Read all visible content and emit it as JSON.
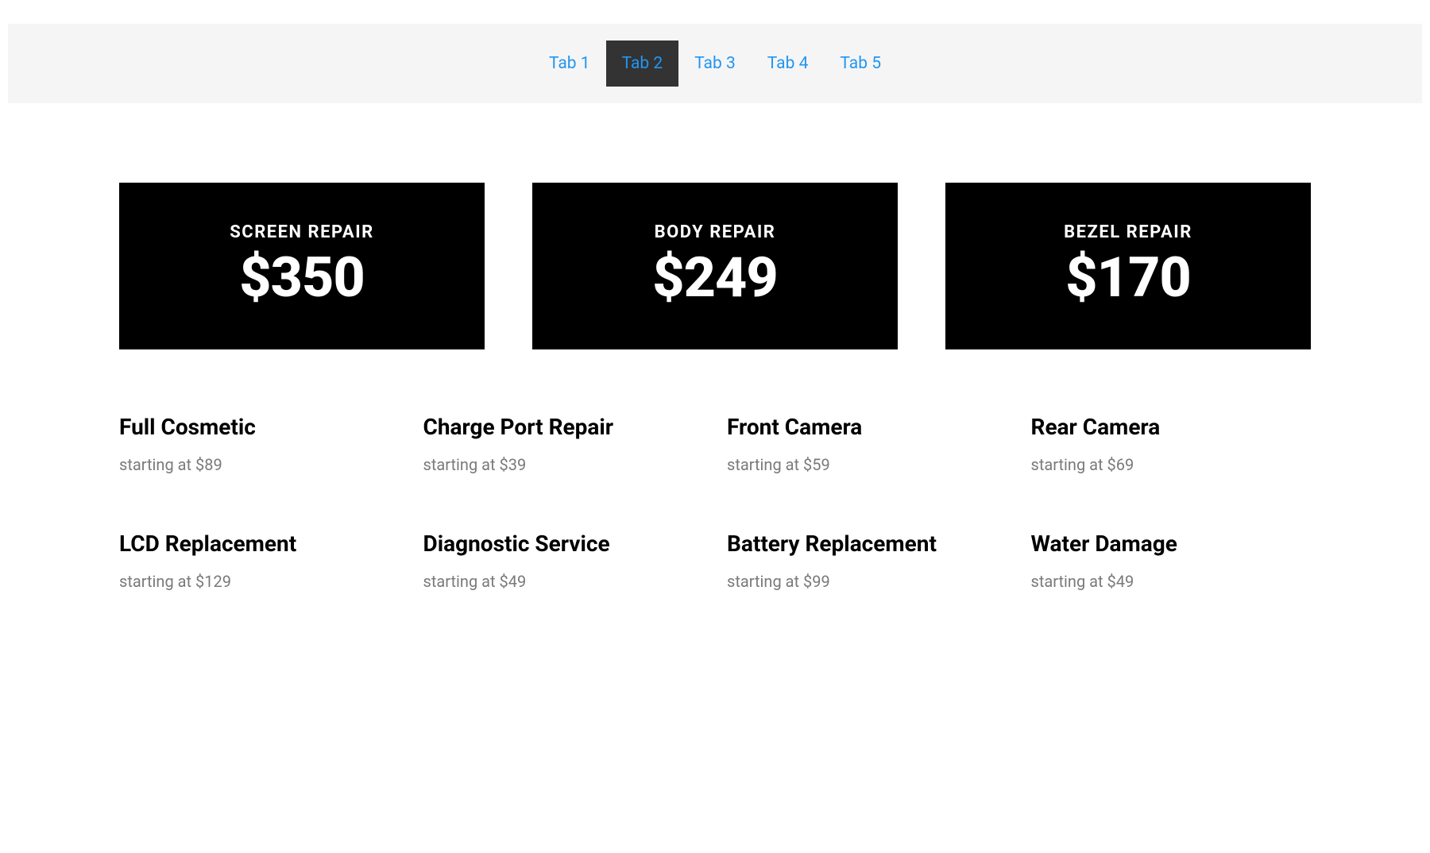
{
  "tabs": {
    "items": [
      {
        "label": "Tab 1",
        "active": false
      },
      {
        "label": "Tab 2",
        "active": true
      },
      {
        "label": "Tab 3",
        "active": false
      },
      {
        "label": "Tab 4",
        "active": false
      },
      {
        "label": "Tab 5",
        "active": false
      }
    ]
  },
  "featured": [
    {
      "title": "SCREEN REPAIR",
      "price": "$350"
    },
    {
      "title": "BODY REPAIR",
      "price": "$249"
    },
    {
      "title": "BEZEL REPAIR",
      "price": "$170"
    }
  ],
  "services": [
    {
      "title": "Full Cosmetic",
      "price": "starting at $89"
    },
    {
      "title": "Charge Port Repair",
      "price": "starting at $39"
    },
    {
      "title": "Front Camera",
      "price": "starting at $59"
    },
    {
      "title": "Rear Camera",
      "price": "starting at $69"
    },
    {
      "title": "LCD Replacement",
      "price": "starting at $129"
    },
    {
      "title": "Diagnostic Service",
      "price": "starting at $49"
    },
    {
      "title": "Battery Replacement",
      "price": "starting at $99"
    },
    {
      "title": "Water Damage",
      "price": "starting at $49"
    }
  ]
}
